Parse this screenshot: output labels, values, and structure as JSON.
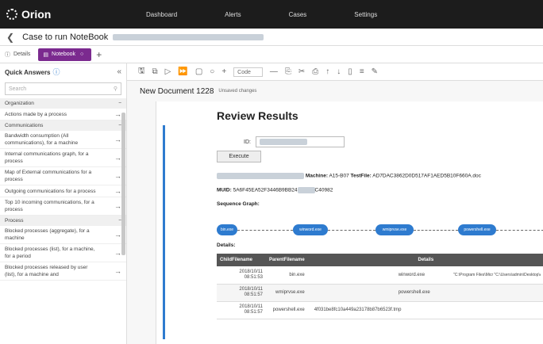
{
  "app": {
    "name": "Orion"
  },
  "nav": [
    "Dashboard",
    "Alerts",
    "Cases",
    "Settings"
  ],
  "case": {
    "title": "Case to run NoteBook"
  },
  "tabs": [
    {
      "label": "Details"
    },
    {
      "label": "Notebook"
    }
  ],
  "sidebar": {
    "title": "Quick Answers",
    "search_placeholder": "Search",
    "groups": [
      {
        "label": "Organization",
        "items": [
          "Actions made by a process"
        ]
      },
      {
        "label": "Communications",
        "items": [
          "Bandwidth consumption (All communications), for a machine",
          "Internal communications graph, for a process",
          "Map of External communications for a process",
          "Outgoing communications for a process",
          "Top 10 incoming communications, for a process"
        ]
      },
      {
        "label": "Process",
        "items": [
          "Blocked processes (aggregate), for a machine",
          "Blocked processes (list), for a machine, for a period",
          "Blocked processes released by user (list), for a machine and"
        ]
      }
    ]
  },
  "toolbar": {
    "cell_type": "Code"
  },
  "document": {
    "name": "New Document 1228",
    "status": "Unsaved changes",
    "review_title": "Review Results",
    "id_label": "ID:",
    "execute_label": "Execute",
    "machine_label": "Machine:",
    "machine_value": "A15-B07",
    "testfile_label": "TestFile:",
    "testfile_value": "AD7DAC3862D0D517AF1AED5B10F660A.doc",
    "muid_label": "MUID:",
    "muid_value": "5A6F45EA52F3446B9BB24",
    "muid_suffix": "C40982",
    "sequence_label": "Sequence Graph:",
    "details_label": "Details:",
    "graph_nodes": [
      "bin.exe",
      "winword.exe",
      "wmiprvse.exe",
      "powershell.exe"
    ],
    "table_headers": [
      "ChildFilename",
      "ParentFilename",
      "Details"
    ],
    "rows": [
      {
        "date": "2018/10/11",
        "time": "08:51:53",
        "child": "bin.exe",
        "parent": "winword.exe",
        "details": "\"C:\\Program Files\\Micr \"C:\\Users\\admin\\Desktop\\AD7"
      },
      {
        "date": "2018/10/11",
        "time": "08:51:57",
        "child": "wmiprvse.exe",
        "parent": "powershell.exe",
        "details": ""
      },
      {
        "date": "2018/10/11",
        "time": "08:51:57",
        "child": "powershell.exe",
        "parent": "4f031be8fc10a449a23178b87b6523f.tmp",
        "details": ""
      }
    ]
  }
}
